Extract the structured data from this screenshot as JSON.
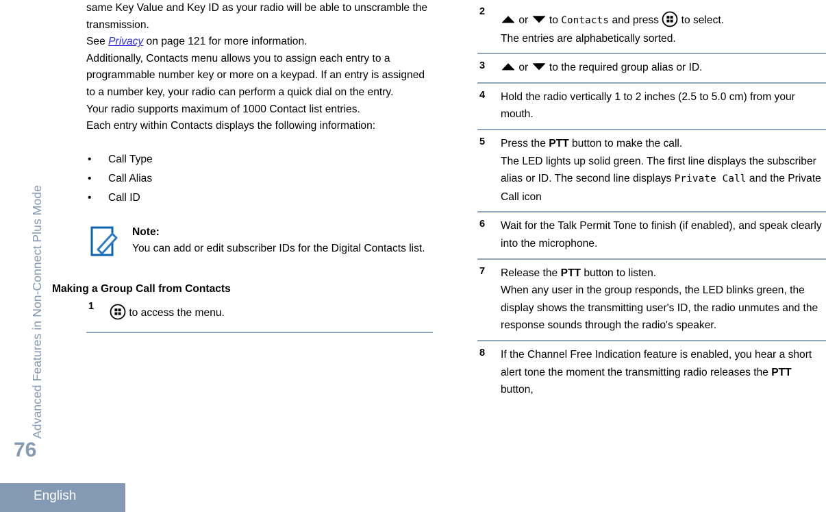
{
  "sidebar": {
    "vertical_label": "Advanced Features in Non-Connect Plus Mode",
    "color": "#8399b4"
  },
  "footer": {
    "page_number": "76",
    "language": "English",
    "band_color": "#8399b4"
  },
  "rule_color": "#8fa5bd",
  "link_color": "#2b2bdd",
  "left_column": {
    "paragraphs": [
      {
        "id": "p_scramble",
        "indented": true,
        "text": "same Key Value and Key ID as your radio will be able to unscramble the transmission."
      },
      {
        "id": "p_see_privacy",
        "indented": true,
        "prefix": "See ",
        "link": "Privacy",
        "suffix": " on page 121 for more information."
      },
      {
        "id": "p_additionally",
        "indented": false,
        "text": "Additionally, Contacts menu allows you to assign each entry to a programmable number key or more on a keypad. If an entry is assigned to a number key, your radio can perform a quick dial on the entry."
      },
      {
        "id": "p_max_entries",
        "indented": false,
        "text": "Your radio supports maximum of 1000 Contact list entries."
      },
      {
        "id": "p_each_entry",
        "indented": false,
        "text": "Each entry within Contacts displays the following information:"
      }
    ],
    "bullet_marker": "•",
    "bullets": [
      "Call Type",
      "Call Alias",
      "Call ID"
    ],
    "note": {
      "icon": "note-pencil-icon",
      "title": "Note:",
      "body": "You can add or edit subscriber IDs for the Digital Contacts list."
    },
    "section_heading": "Making a Group Call from Contacts",
    "steps": [
      {
        "number": "1",
        "icon": "menu-button-icon",
        "text": " to access the menu."
      }
    ]
  },
  "right_column": {
    "steps": [
      {
        "number": "2",
        "segments": [
          {
            "type": "icon",
            "name": "up-arrow-icon"
          },
          {
            "type": "text",
            "value": " or "
          },
          {
            "type": "icon",
            "name": "down-arrow-icon"
          },
          {
            "type": "text",
            "value": " to "
          },
          {
            "type": "display",
            "value": "Contacts"
          },
          {
            "type": "text",
            "value": " and press "
          },
          {
            "type": "icon",
            "name": "menu-button-icon"
          },
          {
            "type": "text",
            "value": " to select."
          }
        ],
        "result": "The entries are alphabetically sorted."
      },
      {
        "number": "3",
        "segments": [
          {
            "type": "icon",
            "name": "up-arrow-icon"
          },
          {
            "type": "text",
            "value": " or "
          },
          {
            "type": "icon",
            "name": "down-arrow-icon"
          },
          {
            "type": "text",
            "value": " to the required group alias or ID."
          }
        ],
        "result": ""
      },
      {
        "number": "4",
        "text": "Hold the radio vertically 1 to 2 inches (2.5 to 5.0 cm) from your mouth.",
        "result": ""
      },
      {
        "number": "5",
        "lead_prefix": "Press the ",
        "lead_bold": "PTT",
        "lead_suffix": " button to make the call.",
        "result_part1": "The LED lights up solid green. The first line displays the subscriber alias or ID. The second line displays ",
        "result_display": "Private Call",
        "result_part2": " and the Private Call icon"
      },
      {
        "number": "6",
        "text": "Wait for the Talk Permit Tone to finish (if enabled), and speak clearly into the microphone.",
        "result": ""
      },
      {
        "number": "7",
        "lead_prefix": "Release the ",
        "lead_bold": "PTT",
        "lead_suffix": " button to listen.",
        "result": "When any user in the group responds, the LED blinks green, the display shows the transmitting user's ID, the radio unmutes and the response sounds through the radio's speaker."
      },
      {
        "number": "8",
        "prefix": "If the Channel Free Indication feature is enabled, you hear a short alert tone the moment the transmitting radio releases the ",
        "bold": "PTT",
        "suffix": " button,"
      }
    ]
  }
}
